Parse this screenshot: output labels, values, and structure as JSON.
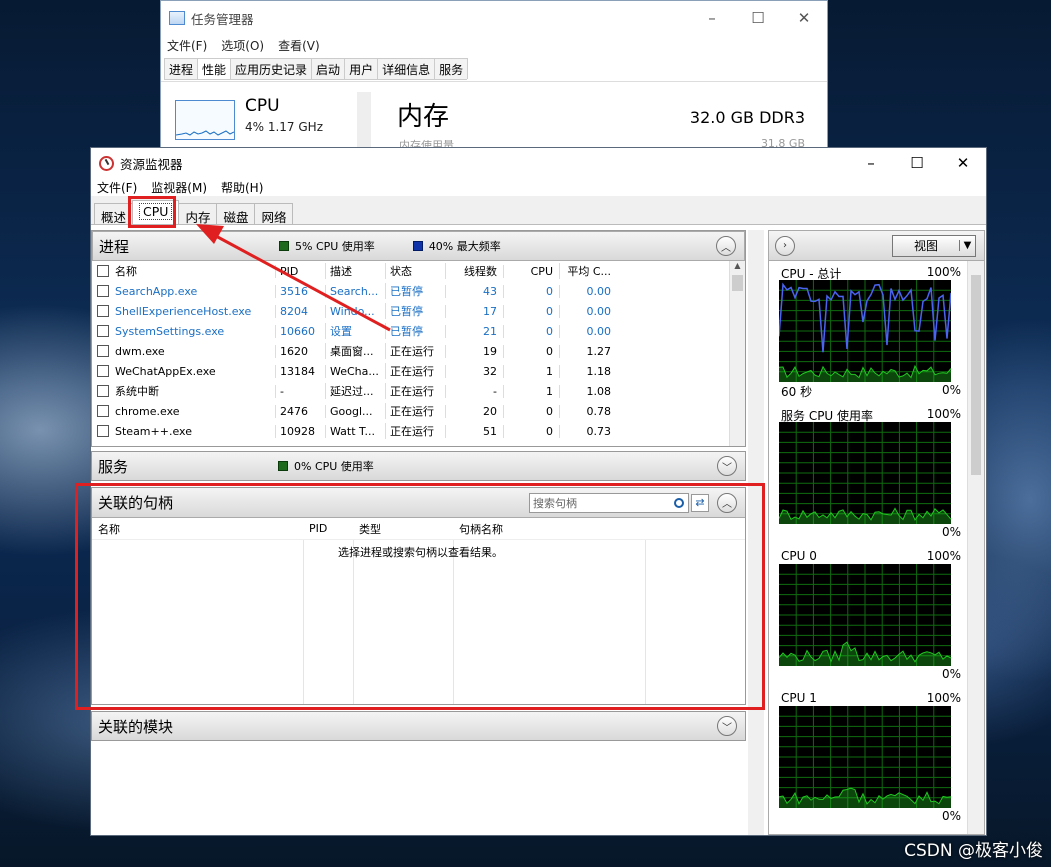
{
  "task_manager": {
    "title": "任务管理器",
    "menu": [
      "文件(F)",
      "选项(O)",
      "查看(V)"
    ],
    "tabs": [
      "进程",
      "性能",
      "应用历史记录",
      "启动",
      "用户",
      "详细信息",
      "服务"
    ],
    "active_tab": "性能",
    "cpu_title": "CPU",
    "cpu_sub": "4% 1.17 GHz",
    "mem_title": "内存",
    "mem_sub": "内存使用量",
    "mem_capacity": "32.0 GB DDR3",
    "mem_total": "31.8 GB"
  },
  "resource_monitor": {
    "title": "资源监视器",
    "menu": [
      "文件(F)",
      "监视器(M)",
      "帮助(H)"
    ],
    "tabs": [
      "概述",
      "CPU",
      "内存",
      "磁盘",
      "网络"
    ],
    "active_tab": "CPU",
    "processes": {
      "title": "进程",
      "cpu_usage": "5% CPU 使用率",
      "max_freq": "40% 最大频率",
      "columns": [
        "名称",
        "PID",
        "描述",
        "状态",
        "线程数",
        "CPU",
        "平均 C..."
      ],
      "rows": [
        {
          "name": "SearchApp.exe",
          "pid": "3516",
          "desc": "Search...",
          "state": "已暂停",
          "threads": "43",
          "cpu": "0",
          "avg": "0.00",
          "suspended": true
        },
        {
          "name": "ShellExperienceHost.exe",
          "pid": "8204",
          "desc": "Windo...",
          "state": "已暂停",
          "threads": "17",
          "cpu": "0",
          "avg": "0.00",
          "suspended": true
        },
        {
          "name": "SystemSettings.exe",
          "pid": "10660",
          "desc": "设置",
          "state": "已暂停",
          "threads": "21",
          "cpu": "0",
          "avg": "0.00",
          "suspended": true
        },
        {
          "name": "dwm.exe",
          "pid": "1620",
          "desc": "桌面窗...",
          "state": "正在运行",
          "threads": "19",
          "cpu": "0",
          "avg": "1.27",
          "suspended": false
        },
        {
          "name": "WeChatAppEx.exe",
          "pid": "13184",
          "desc": "WeCha...",
          "state": "正在运行",
          "threads": "32",
          "cpu": "1",
          "avg": "1.18",
          "suspended": false
        },
        {
          "name": "系统中断",
          "pid": "-",
          "desc": "延迟过...",
          "state": "正在运行",
          "threads": "-",
          "cpu": "1",
          "avg": "1.08",
          "suspended": false
        },
        {
          "name": "chrome.exe",
          "pid": "2476",
          "desc": "Googl...",
          "state": "正在运行",
          "threads": "20",
          "cpu": "0",
          "avg": "0.78",
          "suspended": false
        },
        {
          "name": "Steam++.exe",
          "pid": "10928",
          "desc": "Watt T...",
          "state": "正在运行",
          "threads": "51",
          "cpu": "0",
          "avg": "0.73",
          "suspended": false
        }
      ]
    },
    "services": {
      "title": "服务",
      "cpu_usage": "0% CPU 使用率"
    },
    "handles": {
      "title": "关联的句柄",
      "search_placeholder": "搜索句柄",
      "columns": [
        "名称",
        "PID",
        "类型",
        "句柄名称"
      ],
      "empty_message": "选择进程或搜索句柄以查看结果。"
    },
    "modules": {
      "title": "关联的模块"
    },
    "view_button": "视图",
    "graphs": [
      {
        "title": "CPU - 总计",
        "max": "100%",
        "left": "60 秒",
        "min": "0%",
        "series": [
          "green",
          "blue"
        ]
      },
      {
        "title": "服务 CPU 使用率",
        "max": "100%",
        "min": "0%",
        "series": [
          "green"
        ]
      },
      {
        "title": "CPU 0",
        "max": "100%",
        "min": "0%",
        "series": [
          "green"
        ]
      },
      {
        "title": "CPU 1",
        "max": "100%",
        "min": "0%",
        "series": [
          "green"
        ]
      }
    ]
  },
  "colors": {
    "suspended_text": "#1a6fc4",
    "annotation_red": "#e02020",
    "graph_bg": "#000000",
    "graph_grid": "#0f6b0f",
    "graph_green": "#21c821",
    "graph_blue": "#4a63f0"
  },
  "watermark": "CSDN @极客小俊"
}
